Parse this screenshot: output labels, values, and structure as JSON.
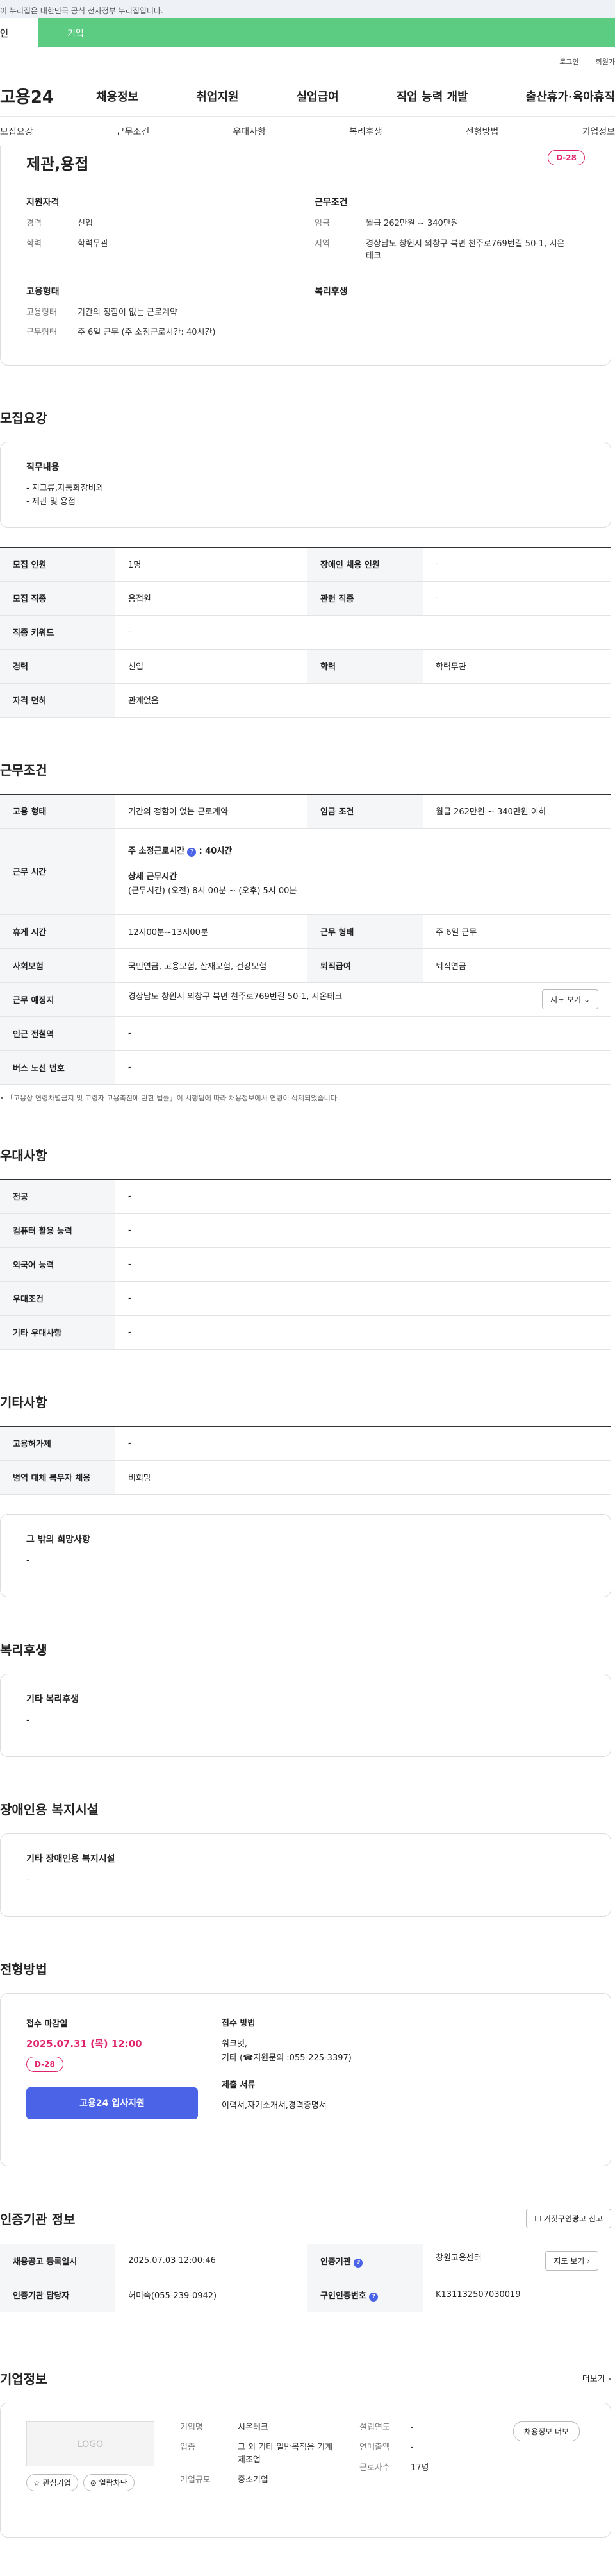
{
  "gov_banner": "이 누리집은 대한민국 공식 전자정부 누리집입니다.",
  "usertype": {
    "left": "인",
    "right": "기업"
  },
  "util": {
    "login": "로그인",
    "join": "회원가"
  },
  "header": {
    "logo": "고용24",
    "menu": [
      "채용정보",
      "취업지원",
      "실업급여",
      "직업 능력 개발",
      "출산휴가·육아휴직"
    ]
  },
  "subtabs": [
    "모집요강",
    "근무조건",
    "우대사항",
    "복리후생",
    "전형방법",
    "기업정보"
  ],
  "top": {
    "title": "제관,용접",
    "dday": "D-28",
    "qualify_title": "지원자격",
    "career_k": "경력",
    "career_v": "신입",
    "edu_k": "학력",
    "edu_v": "학력무관",
    "work_title": "근무조건",
    "pay_k": "임금",
    "pay_v": "월급 262만원 ~ 340만원",
    "area_k": "지역",
    "area_v": "경상남도 창원시 의창구 북면 천주로769번길 50-1, 시온테크",
    "emp_title": "고용형태",
    "emptype_k": "고용형태",
    "emptype_v": "기간의 정함이 없는 근로계약",
    "worktype_k": "근무형태",
    "worktype_v": "주 6일 근무 (주 소정근로시간: 40시간)",
    "welfare_title": "복리후생"
  },
  "recruit": {
    "title": "모집요강",
    "duty_title": "직무내용",
    "duty_lines": [
      "- 지그류,자동화장비외",
      "- 제관 및 용접"
    ],
    "rows": [
      {
        "k1": "모집 인원",
        "v1": "1명",
        "k2": "장애인 채용 인원",
        "v2": "-"
      },
      {
        "k1": "모집 직종",
        "v1": "용접원",
        "k2": "관련 직종",
        "v2": "-"
      },
      {
        "k1": "직종 키워드",
        "v1": "-"
      },
      {
        "k1": "경력",
        "v1": "신입",
        "k2": "학력",
        "v2": "학력무관"
      },
      {
        "k1": "자격 면허",
        "v1": "관계없음"
      }
    ]
  },
  "work": {
    "title": "근무조건",
    "emp_k": "고용 형태",
    "emp_v": "기간의 정함이 없는 근로계약",
    "pay_k": "임금 조건",
    "pay_v": "월급 262만원 ~ 340만원 이하",
    "time_k": "근무 시간",
    "time_l1": "주 소정근로시간",
    "time_l1b": ": 40시간",
    "time_l2": "상세 근무시간",
    "time_l3": "(근무시간) (오전) 8시 00분 ~ (오후) 5시 00분",
    "rest_k": "휴게 시간",
    "rest_v": "12시00분~13시00분",
    "wtype_k": "근무 형태",
    "wtype_v": "주 6일 근무",
    "ins_k": "사회보험",
    "ins_v": "국민연금, 고용보험, 산재보험, 건강보험",
    "ret_k": "퇴직급여",
    "ret_v": "퇴직연금",
    "place_k": "근무 예정지",
    "place_v": "경상남도 창원시 의창구 북면 천주로769번길 50-1, 시온테크",
    "map_btn": "지도 보기",
    "station_k": "인근 전철역",
    "station_v": "-",
    "bus_k": "버스 노선 번호",
    "bus_v": "-",
    "note": "「고용상 연령차별금지 및 고령자 고용촉진에 관한 법률」이 시행됨에 따라 채용정보에서 연령이 삭제되었습니다."
  },
  "pref": {
    "title": "우대사항",
    "rows": [
      {
        "k": "전공",
        "v": "-"
      },
      {
        "k": "컴퓨터 활용 능력",
        "v": "-"
      },
      {
        "k": "외국어 능력",
        "v": "-"
      },
      {
        "k": "우대조건",
        "v": "-"
      },
      {
        "k": "기타 우대사항",
        "v": "-"
      }
    ]
  },
  "etc": {
    "title": "기타사항",
    "rows": [
      {
        "k": "고용허가제",
        "v": "-"
      },
      {
        "k": "병역 대체 복무자 채용",
        "v": "비희망"
      }
    ],
    "box_title": "그 밖의 희망사항",
    "box_v": "-"
  },
  "welfare": {
    "title": "복리후생",
    "box_title": "기타 복리후생",
    "box_v": "-"
  },
  "disab": {
    "title": "장애인용 복지시설",
    "box_title": "기타 장애인용 복지시설",
    "box_v": "-"
  },
  "process": {
    "title": "전형방법",
    "deadline_title": "접수 마감일",
    "deadline": "2025.07.31 (목) 12:00",
    "dday": "D-28",
    "apply_btn": "고용24 입사지원",
    "method_title": "접수 방법",
    "method_l1": "워크넷,",
    "method_l2": "기타 (☎지원문의 :055-225-3397)",
    "docs_title": "제출 서류",
    "docs": "이력서,자기소개서,경력증명서"
  },
  "cert": {
    "title": "인증기관 정보",
    "report_btn": "거짓구인광고 신고",
    "r1k1": "채용공고 등록일시",
    "r1v1": "2025.07.03 12:00:46",
    "r1k2": "인증기관",
    "r1v2": "창원고용센터",
    "map_btn": "지도 보기",
    "r2k1": "인증기관 담당자",
    "r2v1": "허미숙(055-239-0942)",
    "r2k2": "구인인증번호",
    "r2v2": "K131132507030019"
  },
  "corp": {
    "title": "기업정보",
    "more": "더보기",
    "logo": "LOGO",
    "fav_btn": "관심기업",
    "block_btn": "열람차단",
    "name_k": "기업명",
    "name_v": "시온테크",
    "industry_k": "업종",
    "industry_v": "그 외 기타 일반목적용 기계 제조업",
    "size_k": "기업규모",
    "size_v": "중소기업",
    "year_k": "설립연도",
    "year_v": "-",
    "sales_k": "연매출액",
    "sales_v": "-",
    "staff_k": "근로자수",
    "staff_v": "17명",
    "jobs_btn": "채용정보 더보"
  }
}
